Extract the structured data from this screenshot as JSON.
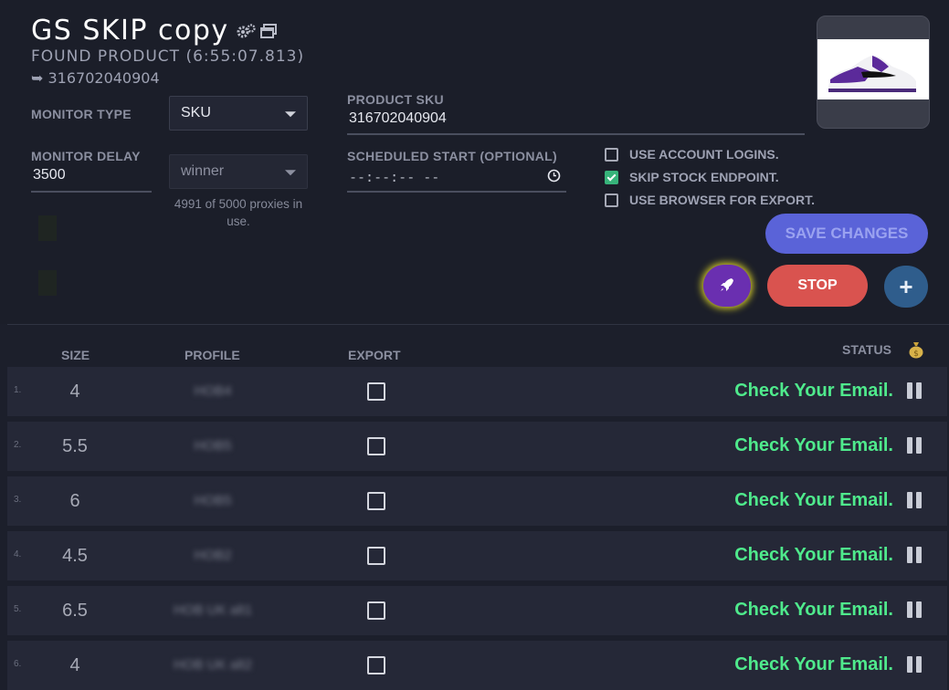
{
  "task": {
    "title": "GS SKIP copy",
    "found_product": "FOUND PRODUCT (6:55:07.813)",
    "sku_line": "➥ 316702040904"
  },
  "form": {
    "monitor_type_label": "MONITOR TYPE",
    "monitor_type_value": "SKU",
    "monitor_delay_label": "MONITOR DELAY",
    "monitor_delay_value": "3500",
    "proxy_select_value": "winner",
    "proxies_info": "4991 of 5000 proxies in use.",
    "product_sku_label": "PRODUCT SKU",
    "product_sku_value": "316702040904",
    "scheduled_start_label": "SCHEDULED START (OPTIONAL)",
    "scheduled_start_placeholder": "--:--:-- --"
  },
  "options": [
    {
      "label": "USE ACCOUNT LOGINS.",
      "checked": false
    },
    {
      "label": "SKIP STOCK ENDPOINT.",
      "checked": true
    },
    {
      "label": "USE BROWSER FOR EXPORT.",
      "checked": false
    }
  ],
  "buttons": {
    "save": "SAVE CHANGES",
    "stop": "STOP",
    "add": "+"
  },
  "table": {
    "headers": {
      "size": "SIZE",
      "profile": "PROFILE",
      "export": "EXPORT",
      "status": "STATUS"
    },
    "rows": [
      {
        "num": "1.",
        "size": "4",
        "profile": "HOB4",
        "status": "Check Your Email."
      },
      {
        "num": "2.",
        "size": "5.5",
        "profile": "HOB5",
        "status": "Check Your Email."
      },
      {
        "num": "3.",
        "size": "6",
        "profile": "HOB5",
        "status": "Check Your Email."
      },
      {
        "num": "4.",
        "size": "4.5",
        "profile": "HOB2",
        "status": "Check Your Email."
      },
      {
        "num": "5.",
        "size": "6.5",
        "profile": "HOB UK alt1",
        "status": "Check Your Email."
      },
      {
        "num": "6.",
        "size": "4",
        "profile": "HOB UK alt2",
        "status": "Check Your Email."
      }
    ]
  },
  "colors": {
    "accent_save": "#5a63d8",
    "stop": "#d9534f",
    "status_green": "#4fea8c",
    "rocket": "#6a2fb0"
  }
}
